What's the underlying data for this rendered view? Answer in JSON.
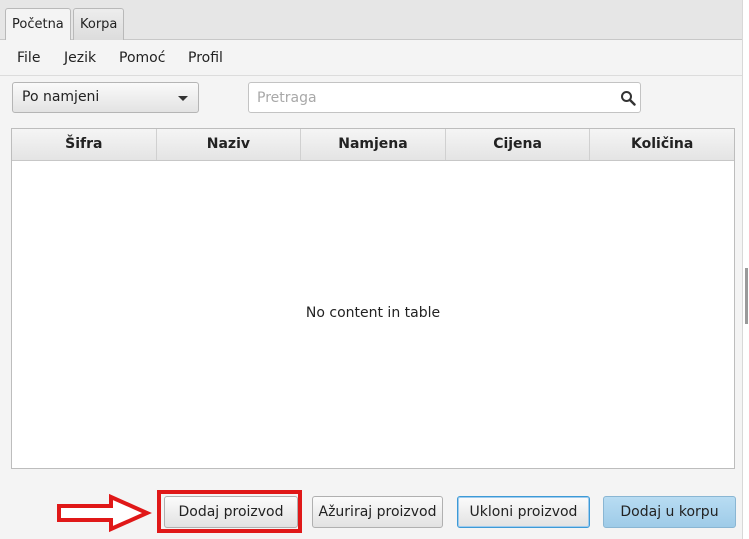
{
  "tabs": [
    {
      "label": "Početna",
      "active": true
    },
    {
      "label": "Korpa",
      "active": false
    }
  ],
  "menu": [
    "File",
    "Jezik",
    "Pomoć",
    "Profil"
  ],
  "filter": {
    "selected": "Po namjeni"
  },
  "search": {
    "placeholder": "Pretraga",
    "value": ""
  },
  "table": {
    "columns": [
      "Šifra",
      "Naziv",
      "Namjena",
      "Cijena",
      "Količina"
    ],
    "empty_text": "No content in table",
    "rows": []
  },
  "buttons": {
    "add_product": "Dodaj proizvod",
    "update_product": "Ažuriraj proizvod",
    "remove_product": "Ukloni proizvod",
    "add_to_cart": "Dodaj u korpu"
  },
  "colors": {
    "highlight": "#e01818",
    "default_button": "#a9d2ec",
    "focus_ring": "#3d9ad6"
  },
  "icons": {
    "search": "search-icon",
    "dropdown": "chevron-down-icon",
    "annotation": "arrow-right-icon"
  }
}
